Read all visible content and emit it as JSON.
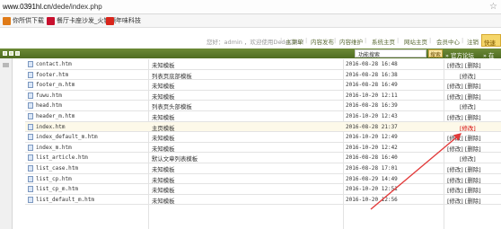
{
  "browser": {
    "url_host": "www.0391hl.cn",
    "url_path": "/dede/index.php",
    "star_icon": "star-icon"
  },
  "bookmarks": [
    {
      "label": "你所供下载",
      "color": "#e07b18"
    },
    {
      "label": "餐厅卡座沙发_火锅桌",
      "color": "#c8102e"
    },
    {
      "label": "年味科技",
      "color": "#d9261c"
    }
  ],
  "topnav": {
    "welcome": "您好：admin ，欢迎使用DedeCMS！",
    "links": [
      "主菜单",
      "内容发布",
      "内容维护",
      "系统主页",
      "网站主页",
      "会员中心",
      "注销"
    ],
    "quick": "快速"
  },
  "band": {
    "search_placeholder": "功能搜索",
    "search_button": "搜索",
    "forum_link": "» 官方论坛",
    "more_link": "» 在"
  },
  "table": {
    "edit_label": "[修改]",
    "delete_label": "[删除]",
    "rows": [
      {
        "name": "contact.htm",
        "desc": "未知模板",
        "date": "2016-08-28 16:48",
        "ops": "[修改] [删除]"
      },
      {
        "name": "footer.htm",
        "desc": "列表页底部模板",
        "date": "2016-08-28 16:38",
        "ops": "[修改]"
      },
      {
        "name": "footer_m.htm",
        "desc": "未知模板",
        "date": "2016-08-28 16:49",
        "ops": "[修改] [删除]"
      },
      {
        "name": "fuwu.htm",
        "desc": "未知模板",
        "date": "2016-10-20 12:11",
        "ops": "[修改] [删除]"
      },
      {
        "name": "head.htm",
        "desc": "列表页头部模板",
        "date": "2016-08-28 16:39",
        "ops": "[修改]"
      },
      {
        "name": "header_m.htm",
        "desc": "未知模板",
        "date": "2016-10-20 12:43",
        "ops": "[修改] [删除]"
      },
      {
        "name": "index.htm",
        "desc": "主页模板",
        "date": "2016-08-28 21:37",
        "ops": "[修改]"
      },
      {
        "name": "index_default_m.htm",
        "desc": "未知模板",
        "date": "2016-10-20 12:49",
        "ops": "[修改] [删除]"
      },
      {
        "name": "index_m.htm",
        "desc": "未知模板",
        "date": "2016-10-20 12:42",
        "ops": "[修改] [删除]"
      },
      {
        "name": "list_article.htm",
        "desc": "默认文章列表模板",
        "date": "2016-08-28 16:40",
        "ops": "[修改]"
      },
      {
        "name": "list_case.htm",
        "desc": "未知模板",
        "date": "2016-08-28 17:01",
        "ops": "[修改] [删除]"
      },
      {
        "name": "list_cp.htm",
        "desc": "未知模板",
        "date": "2016-08-29 14:49",
        "ops": "[修改] [删除]"
      },
      {
        "name": "list_cp_m.htm",
        "desc": "未知模板",
        "date": "2016-10-20 12:51",
        "ops": "[修改] [删除]"
      },
      {
        "name": "list_default_m.htm",
        "desc": "未知模板",
        "date": "2016-10-20 12:56",
        "ops": "[修改] [删除]"
      }
    ]
  },
  "annotation": {
    "arrow_color": "#e23a3a",
    "edit_highlight_color": "#d40000"
  }
}
